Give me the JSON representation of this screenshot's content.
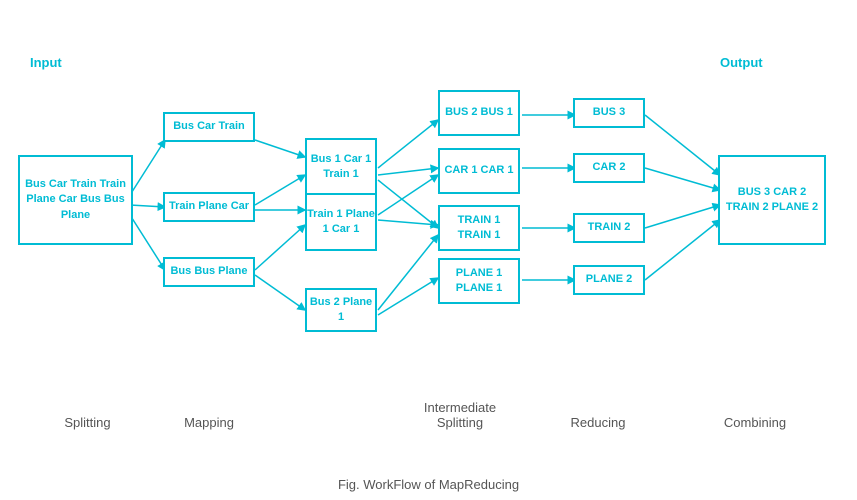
{
  "title": "Fig. WorkFlow of MapReducing",
  "labels": {
    "input": "Input",
    "output": "Output",
    "splitting": "Splitting",
    "mapping": "Mapping",
    "intermediate_splitting": "Intermediate\nSplitting",
    "reducing": "Reducing",
    "combining": "Combining"
  },
  "boxes": {
    "input": "Bus Car Train\nTrain Plane Car\nBus Bus Plane",
    "split1": "Bus Car Train",
    "split2": "Train Plane Car",
    "split3": "Bus Bus Plane",
    "map1": "Bus 1\nCar 1\nTrain 1",
    "map2": "Train 1\nPlane 1\nCar 1",
    "map3": "Bus 2\nPlane 1",
    "inter1": "BUS 2\nBUS 1",
    "inter2": "CAR 1\nCAR 1",
    "inter3": "TRAIN 1\nTRAIN 1",
    "inter4": "PLANE 1\nPLANE 1",
    "reduce1": "BUS 3",
    "reduce2": "CAR 2",
    "reduce3": "TRAIN 2",
    "reduce4": "PLANE 2",
    "output": "BUS 3\nCAR 2\nTRAIN 2\nPLANE 2"
  }
}
